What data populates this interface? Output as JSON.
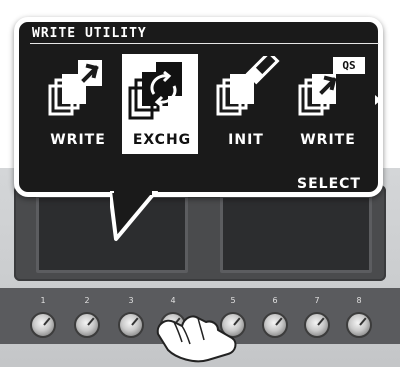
{
  "screen": {
    "title": "WRITE UTILITY",
    "items": [
      {
        "label": "WRITE",
        "icon": "write-arrow-icon",
        "selected": false
      },
      {
        "label": "EXCHG",
        "icon": "exchange-icon",
        "selected": true
      },
      {
        "label": "INIT",
        "icon": "eraser-icon",
        "selected": false
      },
      {
        "label": "WRITE",
        "icon": "write-quick-setting-icon",
        "selected": false,
        "badge": "QS"
      }
    ],
    "more_indicator": "chevron-right-icon",
    "softkey_label": "SELECT"
  },
  "panel": {
    "knobs": [
      "1",
      "2",
      "3",
      "4",
      "5",
      "6",
      "7",
      "8"
    ],
    "active_knob": "4"
  },
  "colors": {
    "lcd_bg": "#1a1a1a",
    "lcd_fg": "#ffffff",
    "panel": "#4a4b4d"
  }
}
